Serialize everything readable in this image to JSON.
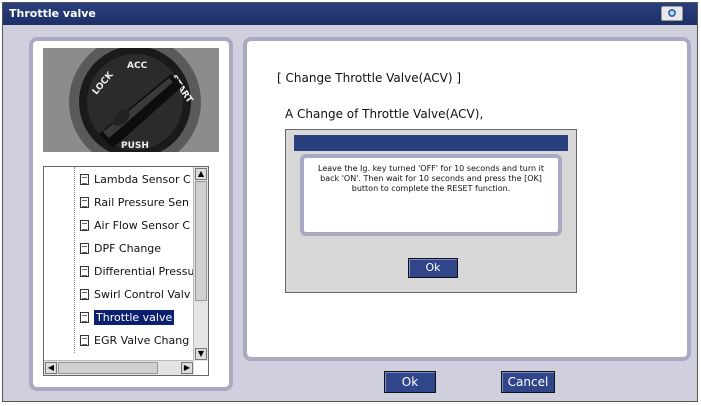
{
  "window": {
    "title": "Throttle valve"
  },
  "tree": {
    "items": [
      {
        "label": "Lambda Sensor C"
      },
      {
        "label": "Rail Pressure Sen"
      },
      {
        "label": "Air Flow Sensor C"
      },
      {
        "label": "DPF Change"
      },
      {
        "label": "Differential Pressu"
      },
      {
        "label": "Swirl Control Valv"
      },
      {
        "label": "Throttle valve",
        "selected": true
      },
      {
        "label": "EGR Valve Chang"
      }
    ]
  },
  "main": {
    "heading": "[ Change Throttle Valve(ACV) ]",
    "subheading": "A Change of Throttle Valve(ACV),"
  },
  "dialog": {
    "message": "Leave the Ig. key turned 'OFF' for 10 seconds and turn it back 'ON'. Then wait for 10 seconds and press the [OK] button to complete the RESET function.",
    "ok_label": "Ok"
  },
  "footer": {
    "ok_label": "Ok",
    "cancel_label": "Cancel"
  },
  "photo": {
    "key_labels": {
      "lock": "LOCK",
      "acc": "ACC",
      "start": "START",
      "push": "PUSH"
    }
  },
  "colors": {
    "titlebar": "#1d2f66",
    "button": "#30458a",
    "panel_border": "#a9a9c4",
    "selection": "#0a1f6e"
  },
  "icons": {
    "title_icon": "camera-icon",
    "tree_item_icon": "document-icon"
  }
}
